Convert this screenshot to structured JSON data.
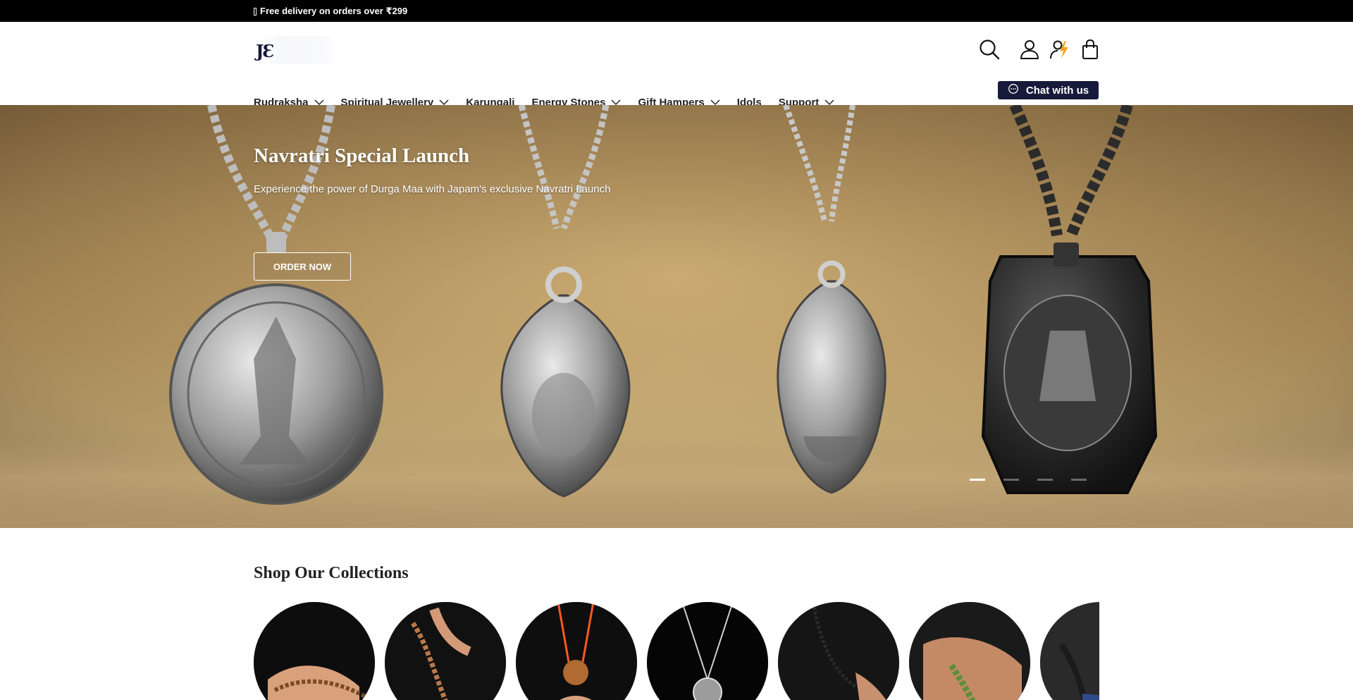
{
  "announcement": {
    "text": "Free delivery on orders over ₹299"
  },
  "header": {
    "logo_text": "JƐ",
    "nav": [
      {
        "label": "Rudraksha",
        "has_dropdown": true
      },
      {
        "label": "Spiritual Jewellery",
        "has_dropdown": true
      },
      {
        "label": "Karungali",
        "has_dropdown": false
      },
      {
        "label": "Energy Stones",
        "has_dropdown": true
      },
      {
        "label": "Gift Hampers",
        "has_dropdown": true
      },
      {
        "label": "Idols",
        "has_dropdown": false
      },
      {
        "label": "Support",
        "has_dropdown": true
      }
    ],
    "chat_label": "Chat with us",
    "icons": [
      "search-icon",
      "account-icon",
      "astro-icon",
      "cart-bag-icon"
    ]
  },
  "hero": {
    "title": "Navratri Special Launch",
    "subtitle": "Experience the power of Durga Maa with Japam's exclusive Navratri Launch",
    "cta_label": "ORDER NOW",
    "slides_count": 4,
    "active_slide": 1
  },
  "collections": {
    "title": "Shop Our Collections",
    "items": [
      "collection-1",
      "collection-2",
      "collection-3",
      "collection-4",
      "collection-5",
      "collection-6",
      "collection-7"
    ]
  },
  "colors": {
    "brand_navy": "#171a3a",
    "announcement_bg": "#000000",
    "accent_orange": "#f5a623"
  }
}
